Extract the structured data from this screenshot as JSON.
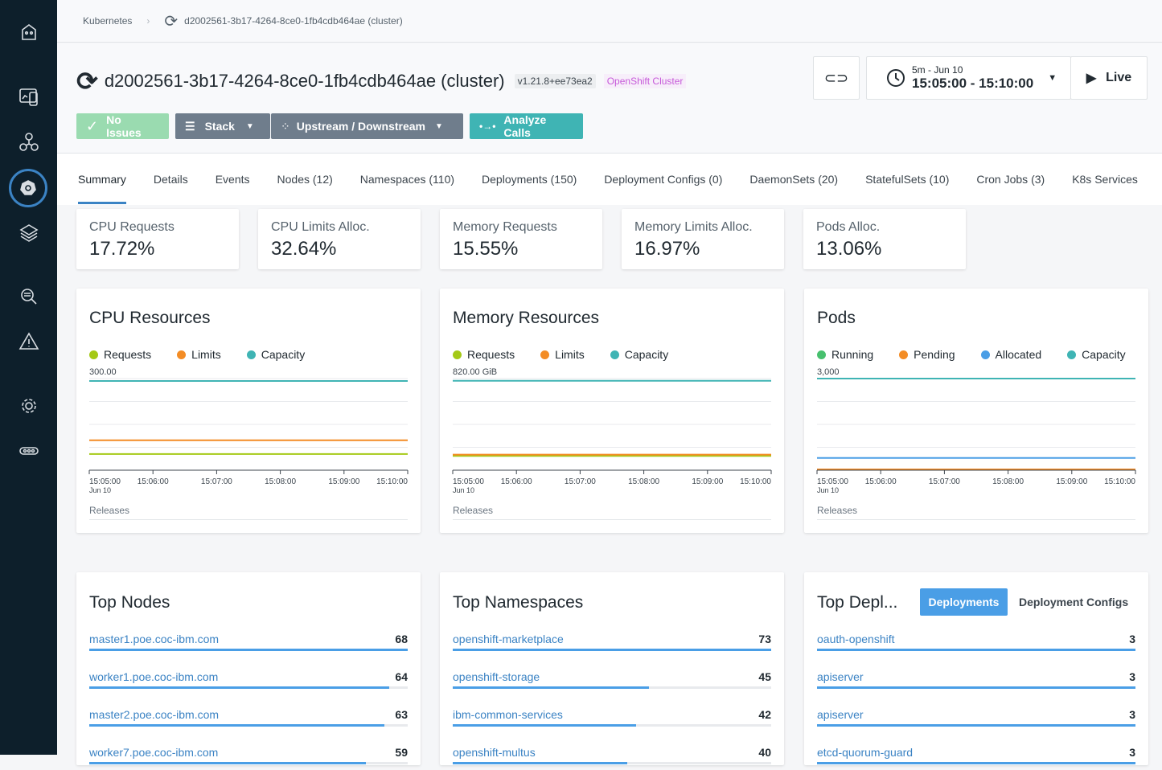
{
  "breadcrumb": {
    "root": "Kubernetes",
    "current": "d2002561-3b17-4264-8ce0-1fb4cdb464ae (cluster)"
  },
  "header": {
    "title": "d2002561-3b17-4264-8ce0-1fb4cdb464ae (cluster)",
    "version": "v1.21.8+ee73ea2",
    "type": "OpenShift Cluster",
    "no_issues": "No Issues",
    "stack": "Stack",
    "updown": "Upstream / Downstream",
    "analyze": "Analyze Calls",
    "range_label": "5m - Jun 10",
    "range": "15:05:00 - 15:10:00",
    "live": "Live"
  },
  "tabs": [
    "Summary",
    "Details",
    "Events",
    "Nodes (12)",
    "Namespaces (110)",
    "Deployments (150)",
    "Deployment Configs (0)",
    "DaemonSets (20)",
    "StatefulSets (10)",
    "Cron Jobs (3)",
    "K8s Services"
  ],
  "stats": [
    {
      "label": "CPU Requests",
      "value": "17.72%"
    },
    {
      "label": "CPU Limits Alloc.",
      "value": "32.64%"
    },
    {
      "label": "Memory Requests",
      "value": "15.55%"
    },
    {
      "label": "Memory Limits Alloc.",
      "value": "16.97%"
    },
    {
      "label": "Pods Alloc.",
      "value": "13.06%"
    }
  ],
  "chart_data": [
    {
      "type": "line",
      "title": "CPU Resources",
      "ymax_label": "300.00",
      "ylim": [
        0,
        300
      ],
      "x": [
        "15:05:00",
        "15:06:00",
        "15:07:00",
        "15:08:00",
        "15:09:00",
        "15:10:00"
      ],
      "x_sub": "Jun 10",
      "footer": "Releases",
      "series": [
        {
          "name": "Requests",
          "color": "#a4c916",
          "value": 53
        },
        {
          "name": "Limits",
          "color": "#f38c25",
          "value": 98
        },
        {
          "name": "Capacity",
          "color": "#3fb4b4",
          "value": 292
        }
      ]
    },
    {
      "type": "line",
      "title": "Memory Resources",
      "ymax_label": "820.00 GiB",
      "ylim": [
        0,
        820
      ],
      "x": [
        "15:05:00",
        "15:06:00",
        "15:07:00",
        "15:08:00",
        "15:09:00",
        "15:10:00"
      ],
      "x_sub": "Jun 10",
      "footer": "Releases",
      "series": [
        {
          "name": "Requests",
          "color": "#a4c916",
          "value": 128
        },
        {
          "name": "Limits",
          "color": "#f38c25",
          "value": 139
        },
        {
          "name": "Capacity",
          "color": "#3fb4b4",
          "value": 800
        }
      ]
    },
    {
      "type": "line",
      "title": "Pods",
      "ymax_label": "3,000",
      "ylim": [
        0,
        3000
      ],
      "x": [
        "15:05:00",
        "15:06:00",
        "15:07:00",
        "15:08:00",
        "15:09:00",
        "15:10:00"
      ],
      "x_sub": "Jun 10",
      "footer": "Releases",
      "series": [
        {
          "name": "Running",
          "color": "#47c06e",
          "value": 0
        },
        {
          "name": "Pending",
          "color": "#f38c25",
          "value": 0
        },
        {
          "name": "Allocated",
          "color": "#4a9ee6",
          "value": 400
        },
        {
          "name": "Capacity",
          "color": "#3fb4b4",
          "value": 3000
        }
      ]
    }
  ],
  "top_nodes": {
    "title": "Top Nodes",
    "max": 68,
    "items": [
      {
        "name": "master1.poe.coc-ibm.com",
        "count": 68
      },
      {
        "name": "worker1.poe.coc-ibm.com",
        "count": 64
      },
      {
        "name": "master2.poe.coc-ibm.com",
        "count": 63
      },
      {
        "name": "worker7.poe.coc-ibm.com",
        "count": 59
      }
    ]
  },
  "top_namespaces": {
    "title": "Top Namespaces",
    "max": 73,
    "items": [
      {
        "name": "openshift-marketplace",
        "count": 73
      },
      {
        "name": "openshift-storage",
        "count": 45
      },
      {
        "name": "ibm-common-services",
        "count": 42
      },
      {
        "name": "openshift-multus",
        "count": 40
      }
    ]
  },
  "top_deployments": {
    "title": "Top Depl...",
    "tab_active": "Deployments",
    "tab_other": "Deployment Configs",
    "max": 3,
    "items": [
      {
        "name": "oauth-openshift",
        "count": 3
      },
      {
        "name": "apiserver",
        "count": 3
      },
      {
        "name": "apiserver",
        "count": 3
      },
      {
        "name": "etcd-quorum-guard",
        "count": 3
      }
    ]
  }
}
